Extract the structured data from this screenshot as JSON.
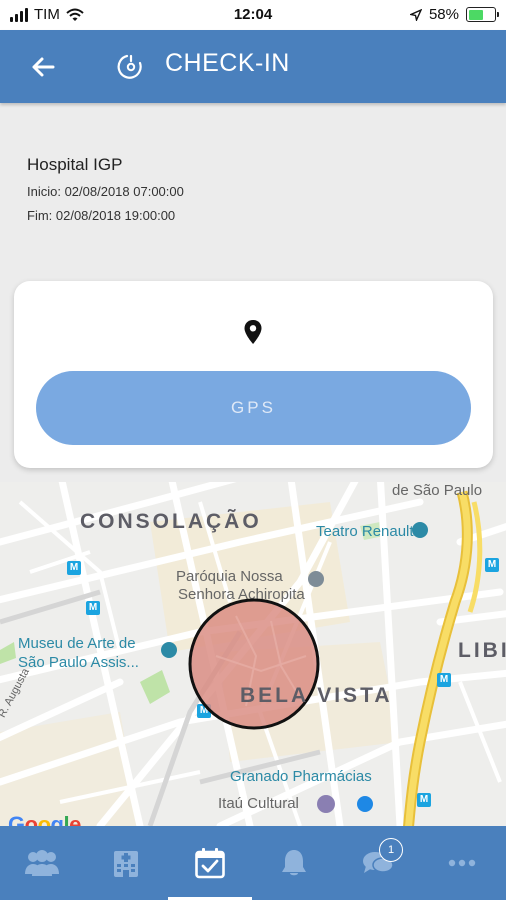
{
  "status_bar": {
    "carrier": "TIM",
    "time": "12:04",
    "battery": "58%"
  },
  "header": {
    "title": "CHECK-IN"
  },
  "info": {
    "name": "Hospital IGP",
    "start": "Inicio: 02/08/2018 07:00:00",
    "end": "Fim: 02/08/2018 19:00:00"
  },
  "card": {
    "gps_label": "GPS"
  },
  "map": {
    "labels": {
      "sao_paulo": "de São Paulo",
      "consolacao": "CONSOLAÇÃO",
      "teatro": "Teatro Renault",
      "paroquia_1": "Paróquia Nossa",
      "paroquia_2": "Senhora Achiropita",
      "museu_1": "Museu de Arte de",
      "museu_2": "São Paulo Assis...",
      "lib": "LIBI",
      "augusta": "R. Augusta",
      "bela_vista": "BELA VISTA",
      "granado": "Granado Pharmácias",
      "itau": "Itaú Cultural",
      "metro": "M",
      "google": "Google"
    },
    "geofence_color": "#d98a80",
    "highway_color": "#f6d349"
  },
  "nav": {
    "items": [
      {
        "icon": "users-icon"
      },
      {
        "icon": "hospital-icon"
      },
      {
        "icon": "calendar-check-icon"
      },
      {
        "icon": "bell-icon"
      },
      {
        "icon": "chat-icon",
        "badge": "1"
      },
      {
        "icon": "more-icon"
      }
    ],
    "active_index": 2
  }
}
